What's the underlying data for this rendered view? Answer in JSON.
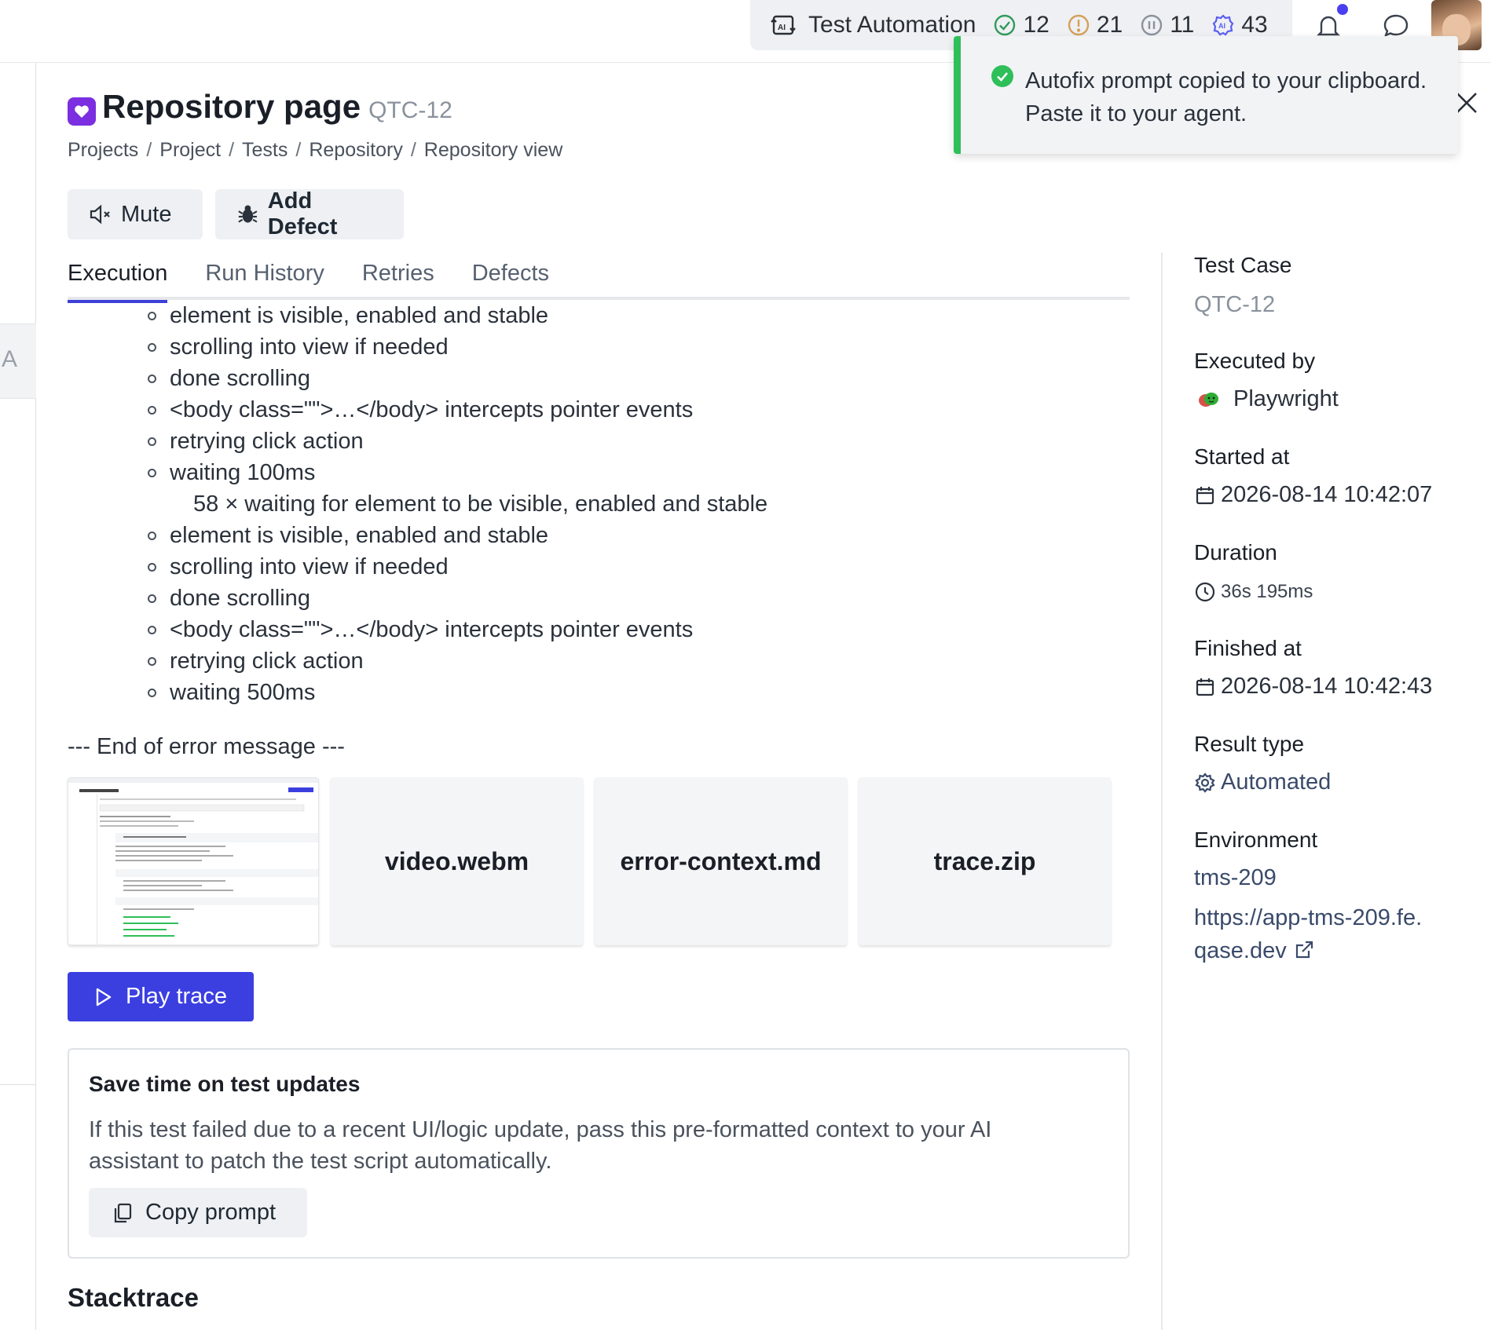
{
  "topbar": {
    "app_title": "Test Automation",
    "stats": [
      {
        "icon": "check-circle-icon",
        "value": "12",
        "color": "#2f9b5a"
      },
      {
        "icon": "warning-circle-icon",
        "value": "21",
        "color": "#d4a05a"
      },
      {
        "icon": "pause-circle-icon",
        "value": "11",
        "color": "#8a929d"
      },
      {
        "icon": "ai-gear-icon",
        "value": "43",
        "color": "#5b5ef0"
      }
    ]
  },
  "sidebar": {
    "collapsed_label": "A"
  },
  "header": {
    "title": "Repository page",
    "key": "QTC-12",
    "breadcrumb": [
      "Projects",
      "Project",
      "Tests",
      "Repository",
      "Repository view"
    ],
    "mute_label": "Mute",
    "add_defect_label": "Add Defect"
  },
  "tabs": [
    {
      "label": "Execution",
      "active": true
    },
    {
      "label": "Run History",
      "active": false
    },
    {
      "label": "Retries",
      "active": false
    },
    {
      "label": "Defects",
      "active": false
    }
  ],
  "log_lines": [
    {
      "text": "element is visible, enabled and stable",
      "sub": false
    },
    {
      "text": "scrolling into view if needed",
      "sub": false
    },
    {
      "text": "done scrolling",
      "sub": false
    },
    {
      "text": "<body class=\"\">…</body> intercepts pointer events",
      "sub": false
    },
    {
      "text": "retrying click action",
      "sub": false
    },
    {
      "text": "waiting 100ms",
      "sub": false
    },
    {
      "text": "58 × waiting for element to be visible, enabled and stable",
      "sub": true
    },
    {
      "text": "element is visible, enabled and stable",
      "sub": false
    },
    {
      "text": "scrolling into view if needed",
      "sub": false
    },
    {
      "text": "done scrolling",
      "sub": false
    },
    {
      "text": "<body class=\"\">…</body> intercepts pointer events",
      "sub": false
    },
    {
      "text": "retrying click action",
      "sub": false
    },
    {
      "text": "waiting 500ms",
      "sub": false
    }
  ],
  "end_message": "--- End of error message ---",
  "attachments": [
    "video.webm",
    "error-context.md",
    "trace.zip"
  ],
  "play_trace_label": "Play trace",
  "save_card": {
    "title": "Save time on test updates",
    "description": "If this test failed due to a recent UI/logic update, pass this pre-formatted context to your AI assistant to patch the test script automatically.",
    "copy_label": "Copy prompt"
  },
  "stacktrace_heading": "Stacktrace",
  "details": {
    "test_case_label": "Test Case",
    "test_case_value": "QTC-12",
    "executed_by_label": "Executed by",
    "executed_by_value": "Playwright",
    "started_label": "Started at",
    "started_value": "2026-08-14 10:42:07",
    "duration_label": "Duration",
    "duration_value": "36s 195ms",
    "finished_label": "Finished at",
    "finished_value": "2026-08-14 10:42:43",
    "result_type_label": "Result type",
    "result_type_value": "Automated",
    "environment_label": "Environment",
    "environment_value": "tms-209",
    "environment_url": "https://app-tms-209.fe.qase.dev"
  },
  "toast": {
    "message": "Autofix prompt copied to your clipboard. Paste it to your agent."
  },
  "colors": {
    "accent": "#3b3fe0",
    "success": "#2fbf59",
    "brand_icon": "#7b2fe0"
  }
}
